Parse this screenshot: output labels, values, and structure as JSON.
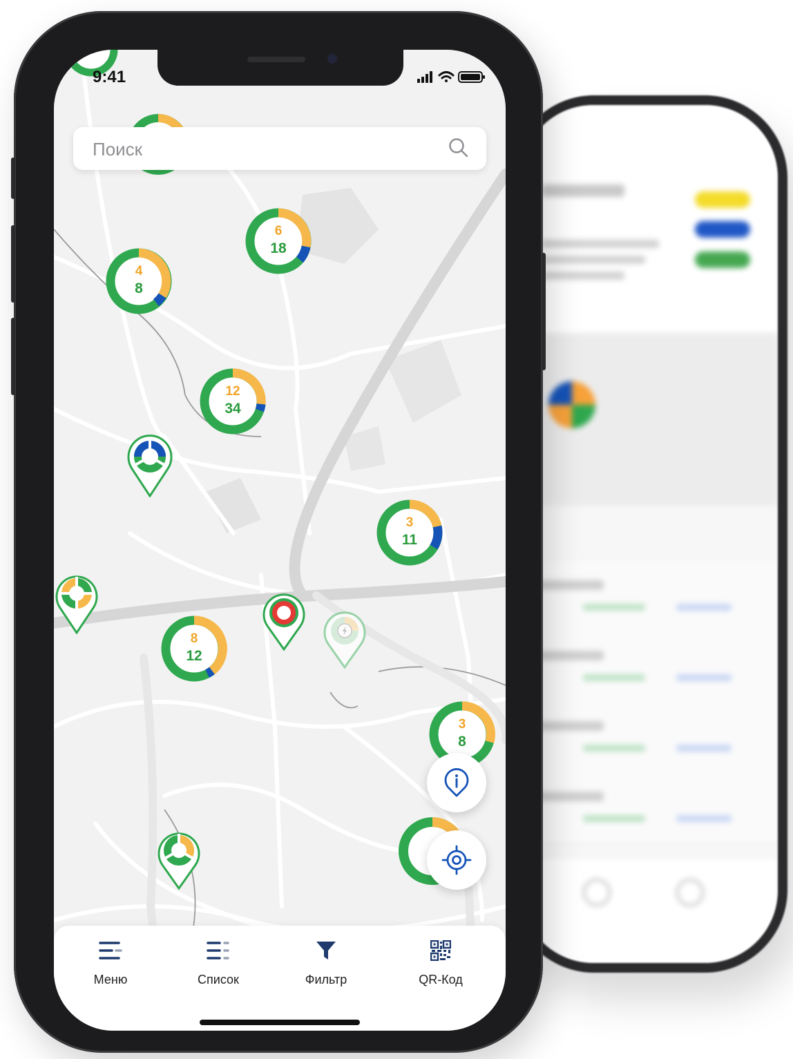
{
  "status_bar": {
    "time": "9:41"
  },
  "search": {
    "placeholder": "Поиск",
    "value": ""
  },
  "clusters": [
    {
      "id": "c1",
      "top": "6",
      "bottom": "18"
    },
    {
      "id": "c2",
      "top": "4",
      "bottom": "8"
    },
    {
      "id": "c3",
      "top": "12",
      "bottom": "34"
    },
    {
      "id": "c4",
      "top": "3",
      "bottom": "11"
    },
    {
      "id": "c5",
      "top": "8",
      "bottom": "12"
    },
    {
      "id": "c6",
      "top": "3",
      "bottom": "8"
    }
  ],
  "tabbar": {
    "items": [
      {
        "label": "Меню",
        "icon": "menu-icon"
      },
      {
        "label": "Список",
        "icon": "list-icon"
      },
      {
        "label": "Фильтр",
        "icon": "filter-icon"
      },
      {
        "label": "QR-Код",
        "icon": "qr-code-icon"
      }
    ]
  },
  "colors": {
    "green": "#2fa84f",
    "orange": "#f7b84b",
    "blue": "#1553b7",
    "red": "#e53935",
    "map_bg": "#f2f2f2",
    "road": "#dcdcdc"
  }
}
